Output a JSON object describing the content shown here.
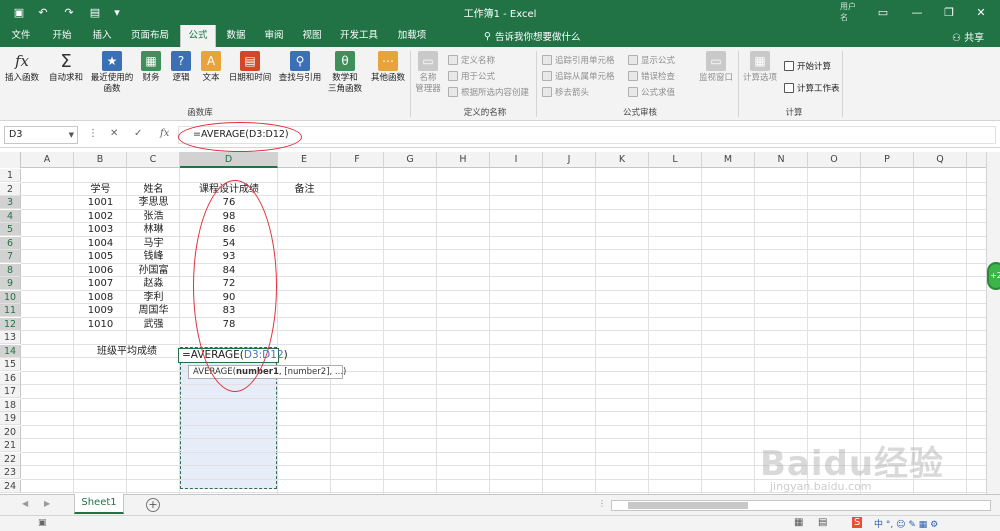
{
  "titlebar": {
    "title": "工作簿1  -  Excel",
    "user": "用户名"
  },
  "tabs": [
    "文件",
    "开始",
    "插入",
    "页面布局",
    "公式",
    "数据",
    "审阅",
    "视图",
    "开发工具",
    "加载项"
  ],
  "active_tab": "公式",
  "tellme": "告诉我你想要做什么",
  "share": "共享",
  "ribbon": {
    "insert_function": "插入函数",
    "autosum": "自动求和",
    "recent": "最近使用的",
    "recent2": "函数",
    "financial": "财务",
    "logical": "逻辑",
    "text": "文本",
    "datetime": "日期和时间",
    "lookup": "查找与引用",
    "math": "数学和",
    "math2": "三角函数",
    "more": "其他函数",
    "group_library": "函数库",
    "name_manager": "名称",
    "name_manager2": "管理器",
    "define_name": "定义名称",
    "use_in_formula": "用于公式",
    "create_from_sel": "根据所选内容创建",
    "group_names": "定义的名称",
    "trace_precedents": "追踪引用单元格",
    "trace_dependents": "追踪从属单元格",
    "remove_arrows": "移去箭头",
    "show_formulas": "显示公式",
    "error_checking": "错误检查",
    "evaluate": "公式求值",
    "group_audit": "公式审核",
    "watch_window": "监视窗口",
    "calc_options": "计算选项",
    "calc_now": "开始计算",
    "calc_sheet": "计算工作表",
    "group_calc": "计算"
  },
  "formula_bar": {
    "name_box": "D3",
    "formula": "=AVERAGE(D3:D12)"
  },
  "columns": [
    "A",
    "B",
    "C",
    "D",
    "E",
    "F",
    "G",
    "H",
    "I",
    "J",
    "K",
    "L",
    "M",
    "N",
    "O",
    "P",
    "Q"
  ],
  "rows": [
    "1",
    "2",
    "3",
    "4",
    "5",
    "6",
    "7",
    "8",
    "9",
    "10",
    "11",
    "12",
    "13",
    "14",
    "15",
    "16",
    "17",
    "18",
    "19",
    "20",
    "21",
    "22",
    "23",
    "24"
  ],
  "headers": {
    "id": "学号",
    "name": "姓名",
    "score": "课程设计成绩",
    "note": "备注"
  },
  "students": [
    {
      "id": "1001",
      "name": "李思思",
      "score": "76"
    },
    {
      "id": "1002",
      "name": "张浩",
      "score": "98"
    },
    {
      "id": "1003",
      "name": "林琳",
      "score": "86"
    },
    {
      "id": "1004",
      "name": "马宇",
      "score": "54"
    },
    {
      "id": "1005",
      "name": "钱峰",
      "score": "93"
    },
    {
      "id": "1006",
      "name": "孙国富",
      "score": "84"
    },
    {
      "id": "1007",
      "name": "赵淼",
      "score": "72"
    },
    {
      "id": "1008",
      "name": "李利",
      "score": "90"
    },
    {
      "id": "1009",
      "name": "周国华",
      "score": "83"
    },
    {
      "id": "1010",
      "name": "武强",
      "score": "78"
    }
  ],
  "avg_label": "班级平均成绩",
  "edit_cell": {
    "prefix": "=AVERAGE(",
    "ref": "D3:D12",
    "suffix": ")"
  },
  "tooltip": {
    "fn": "AVERAGE(",
    "arg1": "number1",
    "rest": ", [number2], ...)"
  },
  "sheet_tab": "Sheet1",
  "watermark": "Baidu经验",
  "watermark_sub": "jingyan.baidu.com",
  "side_badge": "+2"
}
